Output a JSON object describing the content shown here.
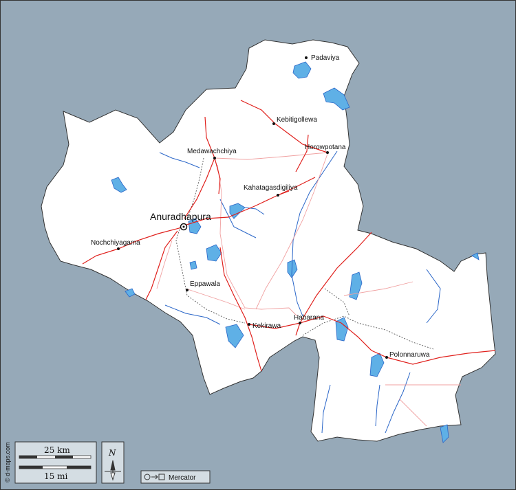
{
  "colors": {
    "sea": "#96a9b8",
    "land": "#ffffff",
    "water": "#5fb0e6",
    "road_major": "#e0201c",
    "road_minor": "#f0a0a0",
    "railway": "#555555",
    "river": "#2a66c8"
  },
  "cities": [
    {
      "name": "Padaviya"
    },
    {
      "name": "Kebitigollewa"
    },
    {
      "name": "Horowpotana"
    },
    {
      "name": "Medawachchiya"
    },
    {
      "name": "Kahatagasdigiliya"
    },
    {
      "name": "Nochchiyagama"
    },
    {
      "name": "Eppawala"
    },
    {
      "name": "Kekirawa"
    },
    {
      "name": "Habarana"
    },
    {
      "name": "Polonnaruwa"
    }
  ],
  "capital": {
    "name": "Anuradhapura"
  },
  "scale": {
    "km_label": "25 km",
    "mi_label": "15 mi"
  },
  "north": {
    "label": "N"
  },
  "projection": {
    "label": "Mercator",
    "icon": "circle-to-square-icon"
  },
  "credit": "© d-maps.com"
}
